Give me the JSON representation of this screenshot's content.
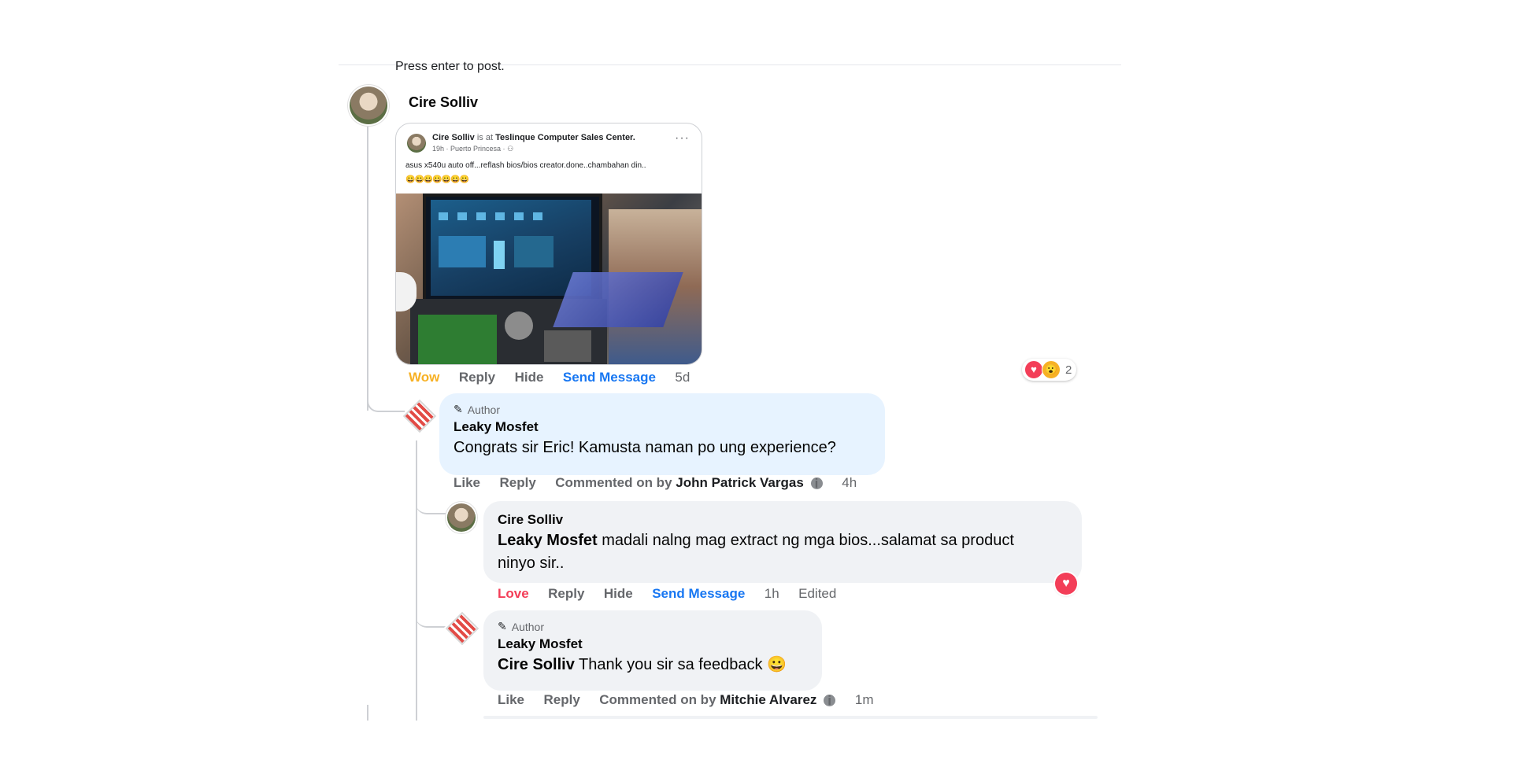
{
  "composer": {
    "hint": "Press enter to post."
  },
  "top_comment": {
    "author": "Cire Solliv",
    "shared_post": {
      "header_name": "Cire Solliv",
      "header_is_at": "is at",
      "header_place": "Teslinque Computer Sales Center.",
      "meta": "19h · Puerto Princesa ·",
      "text": "asus x540u auto off...reflash bios/bios creator.done..chambahan din..",
      "emojis": "😀😀😀😀😀😀😀"
    },
    "actions": {
      "react": "Wow",
      "reply": "Reply",
      "hide": "Hide",
      "send": "Send Message",
      "time": "5d"
    },
    "reaction_count": "2"
  },
  "reply1": {
    "tag": "Author",
    "author": "Leaky Mosfet",
    "text": "Congrats sir Eric! Kamusta naman po ung experience?",
    "actions": {
      "like": "Like",
      "reply": "Reply",
      "commented_on": "Commented on by",
      "by_name": "John Patrick Vargas",
      "time": "4h"
    }
  },
  "reply2": {
    "author": "Cire Solliv",
    "mention": "Leaky Mosfet",
    "text": " madali nalng mag extract ng mga bios...salamat sa product ninyo sir..",
    "actions": {
      "react": "Love",
      "reply": "Reply",
      "hide": "Hide",
      "send": "Send Message",
      "time": "1h",
      "edited": "Edited"
    }
  },
  "reply3": {
    "tag": "Author",
    "author": "Leaky Mosfet",
    "mention": "Cire Solliv",
    "text": " Thank you sir sa feedback 😀",
    "actions": {
      "like": "Like",
      "reply": "Reply",
      "commented_on": "Commented on by",
      "by_name": "Mitchie Alvarez",
      "time": "1m"
    }
  },
  "colors": {
    "link": "#1877f2",
    "wow": "#f7b125",
    "love": "#f33e58",
    "bubble": "#f0f2f5",
    "author_bubble": "#e7f3ff"
  },
  "icons": [
    "pencil-icon",
    "heart-icon",
    "wow-icon",
    "info-icon",
    "more-icon",
    "globe-icon"
  ]
}
